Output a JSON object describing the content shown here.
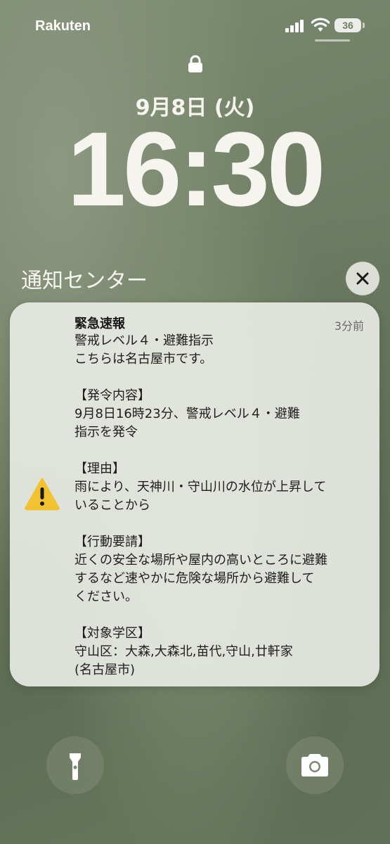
{
  "status_bar": {
    "carrier": "Rakuten",
    "battery": "36"
  },
  "lock_screen": {
    "date": "9月8日 (火)",
    "time": "16:30"
  },
  "notification_center": {
    "title": "通知センター"
  },
  "notification": {
    "title": "緊急速報",
    "time_ago": "3分前",
    "body": "警戒レベル４・避難指示\nこちらは名古屋市です。\n\n【発令内容】\n9月8日16時23分、警戒レベル４・避難\n指示を発令\n\n【理由】\n雨により、天神川・守山川の水位が上昇して\nいることから\n\n【行動要請】\n近くの安全な場所や屋内の高いところに避難\nするなど速やかに危険な場所から避難して\nください。\n\n【対象学区】\n守山区：大森,大森北,苗代,守山,廿軒家\n(名古屋市)",
    "icon": "warning-triangle-icon",
    "icon_color": "#f2c230"
  },
  "bottom": {
    "left_icon": "flashlight-icon",
    "right_icon": "camera-icon"
  }
}
